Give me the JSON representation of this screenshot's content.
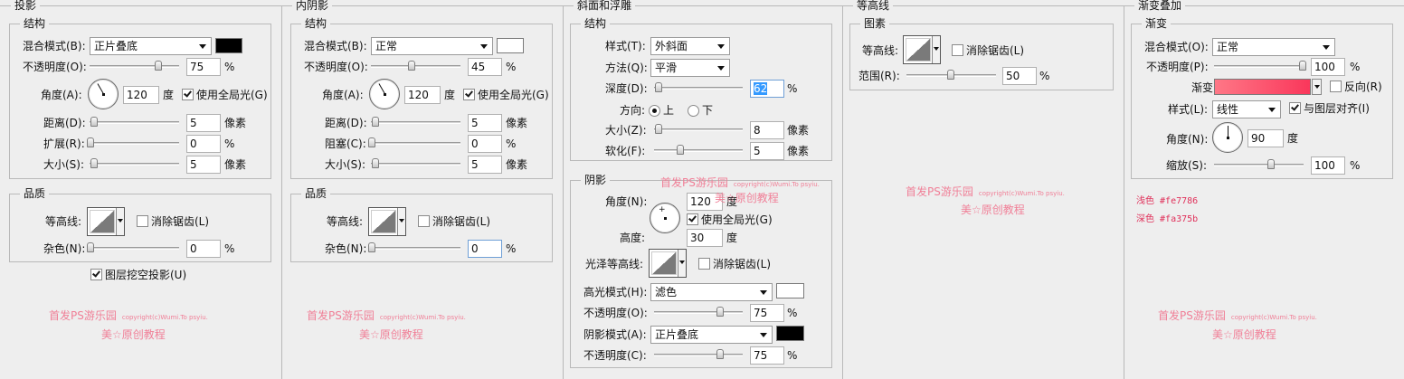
{
  "watermark": {
    "line1": "首发PS游乐园",
    "line1_small": "copyright(c)Wumi.To psyiu.",
    "line2": "美☆原创教程"
  },
  "drop_shadow": {
    "title": "投影",
    "structure": {
      "legend": "结构",
      "blend_mode_label": "混合模式(B):",
      "blend_mode": "正片叠底",
      "color": "#000000",
      "opacity_label": "不透明度(O):",
      "opacity": "75",
      "opacity_pct": 75,
      "angle_label": "角度(A):",
      "angle": "120",
      "angle_unit": "度",
      "global_light_label": "使用全局光(G)",
      "distance_label": "距离(D):",
      "distance": "5",
      "spread_label": "扩展(R):",
      "spread": "0",
      "size_label": "大小(S):",
      "size": "5",
      "px_unit": "像素",
      "pct_unit": "%"
    },
    "quality": {
      "legend": "品质",
      "contour_label": "等高线:",
      "antialias_label": "消除锯齿(L)",
      "noise_label": "杂色(N):",
      "noise": "0"
    },
    "knockout_label": "图层挖空投影(U)"
  },
  "inner_shadow": {
    "title": "内阴影",
    "structure": {
      "legend": "结构",
      "blend_mode_label": "混合模式(B):",
      "blend_mode": "正常",
      "color": "#ffffff",
      "opacity_label": "不透明度(O):",
      "opacity": "45",
      "opacity_pct": 45,
      "angle_label": "角度(A):",
      "angle": "120",
      "angle_unit": "度",
      "global_light_label": "使用全局光(G)",
      "distance_label": "距离(D):",
      "distance": "5",
      "choke_label": "阻塞(C):",
      "choke": "0",
      "size_label": "大小(S):",
      "size": "5",
      "px_unit": "像素",
      "pct_unit": "%"
    },
    "quality": {
      "legend": "品质",
      "contour_label": "等高线:",
      "antialias_label": "消除锯齿(L)",
      "noise_label": "杂色(N):",
      "noise": "0"
    }
  },
  "bevel": {
    "title": "斜面和浮雕",
    "structure": {
      "legend": "结构",
      "style_label": "样式(T):",
      "style": "外斜面",
      "technique_label": "方法(Q):",
      "technique": "平滑",
      "depth_label": "深度(D):",
      "depth": "62",
      "direction_label": "方向:",
      "direction_up": "上",
      "direction_down": "下",
      "size_label": "大小(Z):",
      "size": "8",
      "soften_label": "软化(F):",
      "soften": "5",
      "px_unit": "像素",
      "pct_unit": "%"
    },
    "shading": {
      "legend": "阴影",
      "angle_label": "角度(N):",
      "angle": "120",
      "angle_unit": "度",
      "global_light_label": "使用全局光(G)",
      "altitude_label": "高度:",
      "altitude": "30",
      "gloss_contour_label": "光泽等高线:",
      "antialias_label": "消除锯齿(L)",
      "highlight_mode_label": "高光模式(H):",
      "highlight_mode": "滤色",
      "highlight_color": "#ffffff",
      "highlight_opacity_label": "不透明度(O):",
      "highlight_opacity": "75",
      "shadow_mode_label": "阴影模式(A):",
      "shadow_mode": "正片叠底",
      "shadow_color": "#000000",
      "shadow_opacity_label": "不透明度(C):",
      "shadow_opacity": "75",
      "pct_unit": "%"
    }
  },
  "contour": {
    "title": "等高线",
    "legend": "图素",
    "contour_label": "等高线:",
    "antialias_label": "消除锯齿(L)",
    "range_label": "范围(R):",
    "range": "50",
    "range_pct": 50,
    "pct_unit": "%"
  },
  "gradient_overlay": {
    "title": "渐变叠加",
    "legend": "渐变",
    "blend_mode_label": "混合模式(O):",
    "blend_mode": "正常",
    "opacity_label": "不透明度(P):",
    "opacity": "100",
    "opacity_pct": 100,
    "gradient_label": "渐变:",
    "gradient_from": "#fe7786",
    "gradient_to": "#fa375b",
    "reverse_label": "反向(R)",
    "style_label": "样式(L):",
    "style": "线性",
    "align_label": "与图层对齐(I)",
    "angle_label": "角度(N):",
    "angle": "90",
    "angle_unit": "度",
    "scale_label": "缩放(S):",
    "scale": "100",
    "pct_unit": "%",
    "notes": [
      {
        "label": "浅色",
        "value": "#fe7786"
      },
      {
        "label": "深色",
        "value": "#fa375b"
      }
    ],
    "note_color": "#e0305a"
  }
}
